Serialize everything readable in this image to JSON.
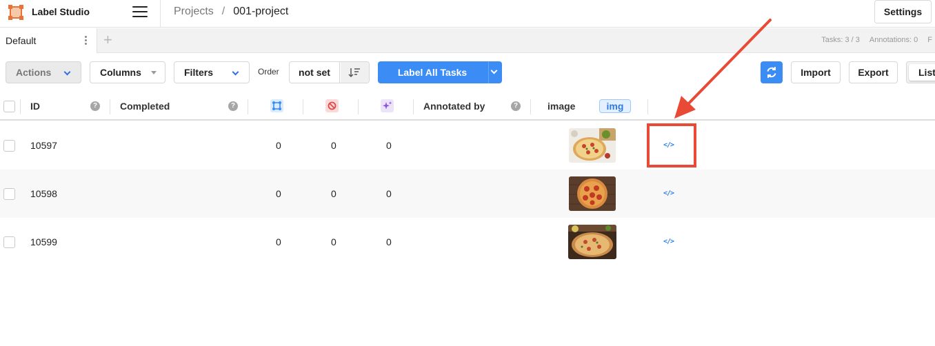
{
  "header": {
    "app_name": "Label Studio",
    "breadcrumb": {
      "root": "Projects",
      "separator": "/",
      "current": "001-project"
    },
    "settings_label": "Settings"
  },
  "tabs": {
    "active_label": "Default",
    "add_symbol": "+",
    "stats": {
      "tasks": "Tasks: 3 / 3",
      "annotations": "Annotations: 0",
      "predictions": "F"
    }
  },
  "toolbar": {
    "actions_label": "Actions",
    "columns_label": "Columns",
    "filters_label": "Filters",
    "order_label": "Order",
    "order_value": "not set",
    "label_all_label": "Label All Tasks",
    "import_label": "Import",
    "export_label": "Export",
    "view_label": "List"
  },
  "table": {
    "columns": {
      "id": "ID",
      "completed": "Completed",
      "annotated_by": "Annotated by",
      "image": "image",
      "image_badge": "img",
      "help_symbol": "?"
    },
    "icon_columns": [
      "total-annotations-icon",
      "cancelled-annotations-icon",
      "predictions-icon"
    ],
    "rows": [
      {
        "id": "10597",
        "total_annotations": "0",
        "cancelled": "0",
        "predictions": "0",
        "code": "</>"
      },
      {
        "id": "10598",
        "total_annotations": "0",
        "cancelled": "0",
        "predictions": "0",
        "code": "</>"
      },
      {
        "id": "10599",
        "total_annotations": "0",
        "cancelled": "0",
        "predictions": "0",
        "code": "</>"
      }
    ]
  },
  "colors": {
    "accent": "#3b8cf5",
    "highlight": "#e84a35",
    "logo": "#e8733a"
  }
}
